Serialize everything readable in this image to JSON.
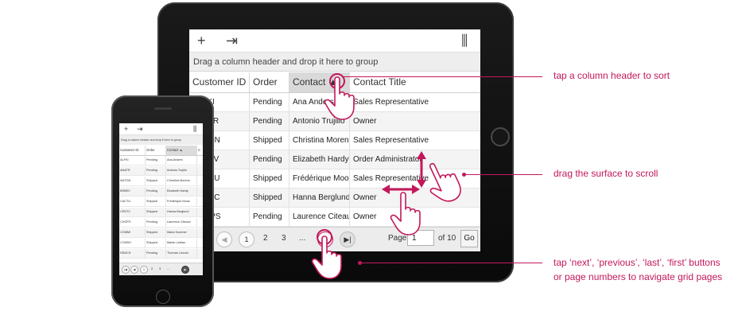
{
  "tablet": {
    "toolbar": {
      "add_icon": "+",
      "export_icon": "⇥",
      "columns_icon": "⫼"
    },
    "group_bar_text": "Drag a column header and drop it here to group",
    "columns": [
      "Customer ID",
      "Order",
      "Contact ▲",
      "Contact Title"
    ],
    "rows": [
      [
        "ALFKI",
        "Pending",
        "Ana Anders",
        "Sales Representative"
      ],
      [
        "ANATR",
        "Pending",
        "Antonio Trujillo",
        "Owner"
      ],
      [
        "ANTON",
        "Shipped",
        "Christina Moreno",
        "Sales Representative"
      ],
      [
        "BSBEV",
        "Pending",
        "Elizabeth Hardy",
        "Order Administrator"
      ],
      [
        "CACTU",
        "Shipped",
        "Frédérique Moos",
        "Sales Representative"
      ],
      [
        "CENTC",
        "Shipped",
        "Hanna Berglund",
        "Owner"
      ],
      [
        "CHOPS",
        "Pending",
        "Laurence Citeaux",
        "Owner"
      ]
    ],
    "pager": {
      "prev_icon": "◀",
      "pages": [
        "1",
        "2",
        "3",
        "..."
      ],
      "next_icon": "▶",
      "last_icon": "▶|",
      "page_label": "Page",
      "page_value": "1",
      "of_label": "of 10",
      "go_label": "Go"
    }
  },
  "phone": {
    "toolbar": {
      "add_icon": "+",
      "export_icon": "⇥",
      "columns_icon": "⫼"
    },
    "group_bar_text": "Drag a column header and drop it here to group",
    "columns": [
      "Customer ID",
      "Order",
      "Contact ▲",
      "C"
    ],
    "rows": [
      [
        "ALFKI",
        "Pending",
        "Ana Anders",
        ""
      ],
      [
        "ANATR",
        "Pending",
        "Antonio Trujillo",
        ""
      ],
      [
        "ANTON",
        "Shipped",
        "Christina Moreno",
        ""
      ],
      [
        "BSBEV",
        "Pending",
        "Elizabeth Hardy",
        ""
      ],
      [
        "CACTU",
        "Shipped",
        "Frédérique Moos",
        ""
      ],
      [
        "CENTC",
        "Shipped",
        "Hanna Berglund",
        ""
      ],
      [
        "CHOPS",
        "Pending",
        "Laurence Citeaux",
        ""
      ],
      [
        "COMMI",
        "Shipped",
        "Maria Sommer",
        ""
      ],
      [
        "CONSH",
        "Shipped",
        "Martin Leblan",
        ""
      ],
      [
        "DRACD",
        "Pending",
        "Thomas Lincoln",
        ""
      ]
    ],
    "pager": {
      "first_icon": "|◀",
      "prev_icon": "◀",
      "pages": [
        "1",
        "2",
        "3",
        "..."
      ],
      "next_icon": "▶"
    }
  },
  "callouts": {
    "sort": "tap a column header to sort",
    "scroll": "drag the surface to scroll",
    "navigate_line1": "tap ‘next’, ‘previous’, ‘last’, ‘first’ buttons",
    "navigate_line2": "or page numbers to navigate grid pages"
  },
  "colors": {
    "accent": "#c2185b",
    "sorted_header": "#d9d9d9"
  }
}
